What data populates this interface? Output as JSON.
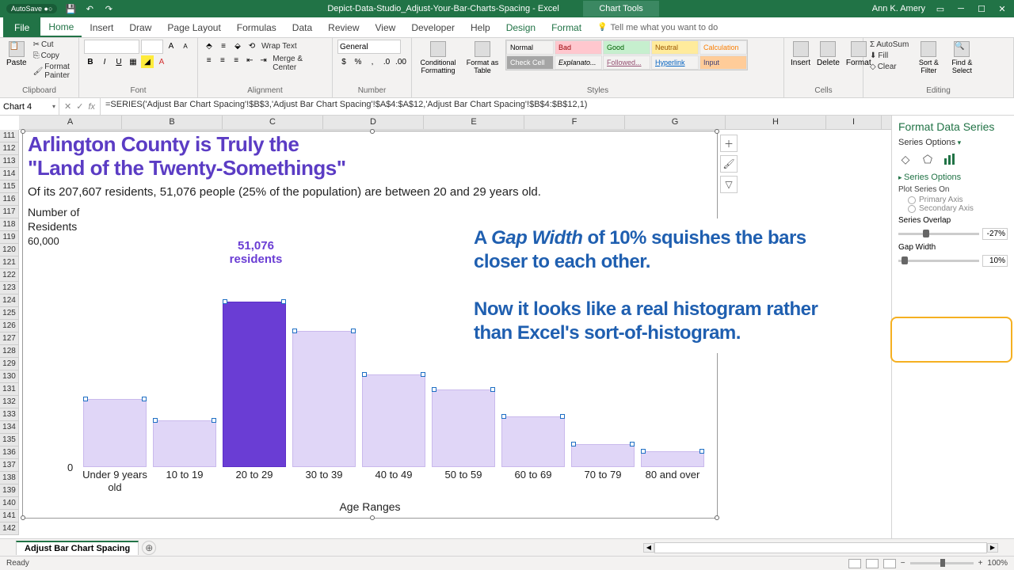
{
  "titlebar": {
    "autosave": "AutoSave ●○",
    "filename": "Depict-Data-Studio_Adjust-Your-Bar-Charts-Spacing  -  Excel",
    "chart_tools": "Chart Tools",
    "user": "Ann K. Amery"
  },
  "tabs": {
    "file": "File",
    "home": "Home",
    "insert": "Insert",
    "draw": "Draw",
    "page_layout": "Page Layout",
    "formulas": "Formulas",
    "data": "Data",
    "review": "Review",
    "view": "View",
    "developer": "Developer",
    "help": "Help",
    "design": "Design",
    "format": "Format",
    "tellme": "Tell me what you want to do"
  },
  "ribbon": {
    "clipboard": {
      "paste": "Paste",
      "cut": "Cut",
      "copy": "Copy",
      "fp": "Format Painter",
      "label": "Clipboard"
    },
    "font": {
      "label": "Font"
    },
    "alignment": {
      "wrap": "Wrap Text",
      "merge": "Merge & Center",
      "label": "Alignment"
    },
    "number": {
      "general": "General",
      "label": "Number"
    },
    "styles": {
      "cf": "Conditional Formatting",
      "ft": "Format as Table",
      "row1": [
        "Normal",
        "Bad",
        "Good",
        "Neutral",
        "Calculation"
      ],
      "row2": [
        "Check Cell",
        "Explanato...",
        "Followed...",
        "Hyperlink",
        "Input"
      ],
      "label": "Styles"
    },
    "cells": {
      "insert": "Insert",
      "delete": "Delete",
      "format": "Format",
      "label": "Cells"
    },
    "editing": {
      "autosum": "AutoSum",
      "fill": "Fill",
      "clear": "Clear",
      "sort": "Sort & Filter",
      "find": "Find & Select",
      "label": "Editing"
    }
  },
  "namebox": "Chart 4",
  "formula": "=SERIES('Adjust Bar Chart Spacing'!$B$3,'Adjust Bar Chart Spacing'!$A$4:$A$12,'Adjust Bar Chart Spacing'!$B$4:$B$12,1)",
  "columns": [
    "A",
    "B",
    "C",
    "D",
    "E",
    "F",
    "G",
    "H",
    "I"
  ],
  "rows": [
    "111",
    "112",
    "113",
    "114",
    "115",
    "116",
    "117",
    "118",
    "119",
    "120",
    "121",
    "122",
    "123",
    "124",
    "125",
    "126",
    "127",
    "128",
    "129",
    "130",
    "131",
    "132",
    "133",
    "134",
    "135",
    "136",
    "137",
    "138",
    "139",
    "140",
    "141",
    "142"
  ],
  "chart": {
    "title1": "Arlington County is Truly the",
    "title2": "\"Land of the Twenty-Somethings\"",
    "subtitle": "Of its 207,607 residents, 51,076 people (25% of the population) are between 20 and 29 years old.",
    "ytitle1": "Number of",
    "ytitle2": "Residents",
    "ymax": "60,000",
    "y0": "0",
    "xlabel": "Age Ranges",
    "datalabel1": "51,076",
    "datalabel2": "residents",
    "annotation1_a": "A ",
    "annotation1_b": "Gap Width",
    "annotation1_c": " of 10% squishes the bars closer to each other.",
    "annotation2": "Now it looks like a real histogram rather than Excel's sort-of-histogram."
  },
  "chart_data": {
    "type": "bar",
    "title": "Arlington County is Truly the \"Land of the Twenty-Somethings\"",
    "xlabel": "Age Ranges",
    "ylabel": "Number of Residents",
    "ylim": [
      0,
      60000
    ],
    "categories": [
      "Under 9 years old",
      "10 to 19",
      "20 to 29",
      "30 to 39",
      "40 to 49",
      "50 to 59",
      "60 to 69",
      "70 to 79",
      "80 and over"
    ],
    "values": [
      21000,
      14500,
      51076,
      42000,
      28500,
      24000,
      15500,
      7000,
      5000
    ],
    "highlight_index": 2,
    "highlight_value_label": "51,076 residents"
  },
  "format_pane": {
    "title": "Format Data Series",
    "subtitle": "Series Options",
    "section": "Series Options",
    "plot_on": "Plot Series On",
    "primary": "Primary Axis",
    "secondary": "Secondary Axis",
    "overlap_label": "Series Overlap",
    "overlap_val": "-27%",
    "gap_label": "Gap Width",
    "gap_val": "10%"
  },
  "sheet_tab": "Adjust Bar Chart Spacing",
  "status": {
    "ready": "Ready",
    "zoom": "100%"
  }
}
